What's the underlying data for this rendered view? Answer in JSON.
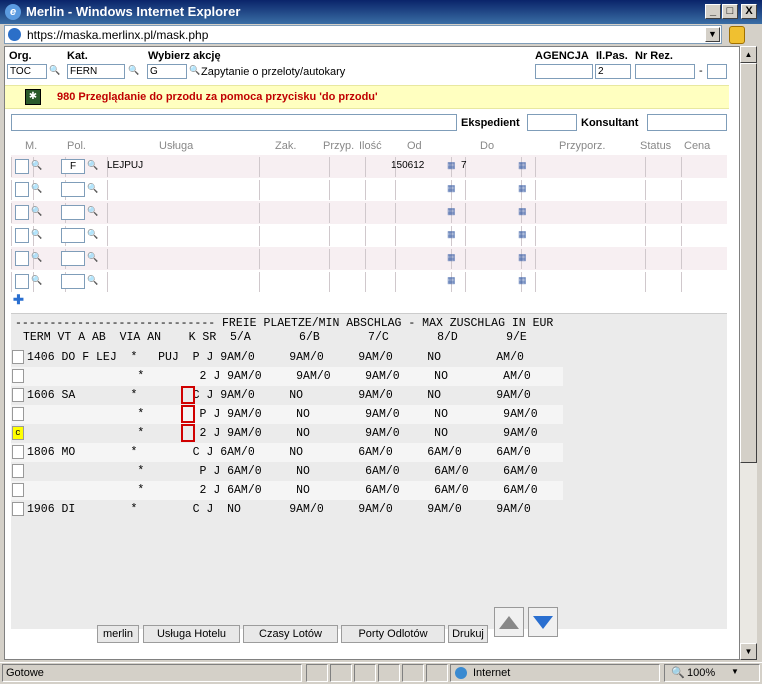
{
  "window": {
    "title": "Merlin - Windows Internet Explorer",
    "minimize": "_",
    "maximize": "□",
    "close": "X"
  },
  "address": {
    "url": "https://maska.merlinx.pl/mask.php"
  },
  "header": {
    "org_label": "Org.",
    "org_value": "TOC",
    "kat_label": "Kat.",
    "kat_value": "FERN",
    "akcja_label": "Wybierz akcję",
    "akcja_value": "G",
    "akcja_desc": "Zapytanie o przeloty/autokary",
    "agencja_label": "AGENCJA",
    "ilpas_label": "Il.Pas.",
    "ilpas_value": "2",
    "nrrez_label": "Nr Rez.",
    "dash": "-"
  },
  "notice": {
    "text": "980 Przeglądanie do przodu za pomoca przycisku 'do przodu'"
  },
  "staff": {
    "ekspedient_label": "Ekspedient",
    "konsultant_label": "Konsultant"
  },
  "columns": {
    "m": "M.",
    "pol": "Pol.",
    "usluga": "Usługa",
    "zak": "Zak.",
    "przyp": "Przyp.",
    "ilosc": "Ilość",
    "od": "Od",
    "do": "Do",
    "przyporz": "Przyporz.",
    "status": "Status",
    "cena": "Cena"
  },
  "service_rows": [
    {
      "pol": "F",
      "usluga": "LEJPUJ",
      "od": "150612",
      "do": "7"
    },
    {
      "pol": "",
      "usluga": "",
      "od": "",
      "do": ""
    },
    {
      "pol": "",
      "usluga": "",
      "od": "",
      "do": ""
    },
    {
      "pol": "",
      "usluga": "",
      "od": "",
      "do": ""
    },
    {
      "pol": "",
      "usluga": "",
      "od": "",
      "do": ""
    },
    {
      "pol": "",
      "usluga": "",
      "od": "",
      "do": ""
    }
  ],
  "gds": {
    "header1": "----------------------------- FREIE PLAETZE/MIN ABSCHLAG - MAX ZUSCHLAG IN EUR",
    "header2": "TERM VT A AB  VIA AN    K SR  5/A       6/B       7/C       8/D       9/E",
    "lines": [
      {
        "cb": "",
        "text": "1406 DO F LEJ  *   PUJ  P J 9AM/0     9AM/0     9AM/0     NO        AM/0"
      },
      {
        "cb": "",
        "text": "                *        2 J 9AM/0     9AM/0     9AM/0     NO        AM/0"
      },
      {
        "cb": "",
        "text": "1606 SA        *        C J 9AM/0     NO        9AM/0     NO        9AM/0"
      },
      {
        "cb": "",
        "text": "                *        P J 9AM/0     NO        9AM/0     NO        9AM/0"
      },
      {
        "cb": "c",
        "text": "                *        2 J 9AM/0     NO        9AM/0     NO        9AM/0"
      },
      {
        "cb": "",
        "text": "1806 MO        *        C J 6AM/0     NO        6AM/0     6AM/0     6AM/0"
      },
      {
        "cb": "",
        "text": "                *        P J 6AM/0     NO        6AM/0     6AM/0     6AM/0"
      },
      {
        "cb": "",
        "text": "                *        2 J 6AM/0     NO        6AM/0     6AM/0     6AM/0"
      },
      {
        "cb": "",
        "text": "1906 DI        *        C J  NO       9AM/0     9AM/0     9AM/0     9AM/0"
      }
    ]
  },
  "buttons": {
    "merlin": "merlin",
    "hotel": "Usługa Hotelu",
    "czasy": "Czasy Lotów",
    "porty": "Porty Odlotów",
    "drukuj": "Drukuj"
  },
  "status": {
    "text": "Gotowe",
    "zone": "Internet",
    "zoom": "100%"
  },
  "colors": {
    "notice_bg": "#ffffc0",
    "notice_text": "#c00000",
    "highlight": "#d00000"
  }
}
